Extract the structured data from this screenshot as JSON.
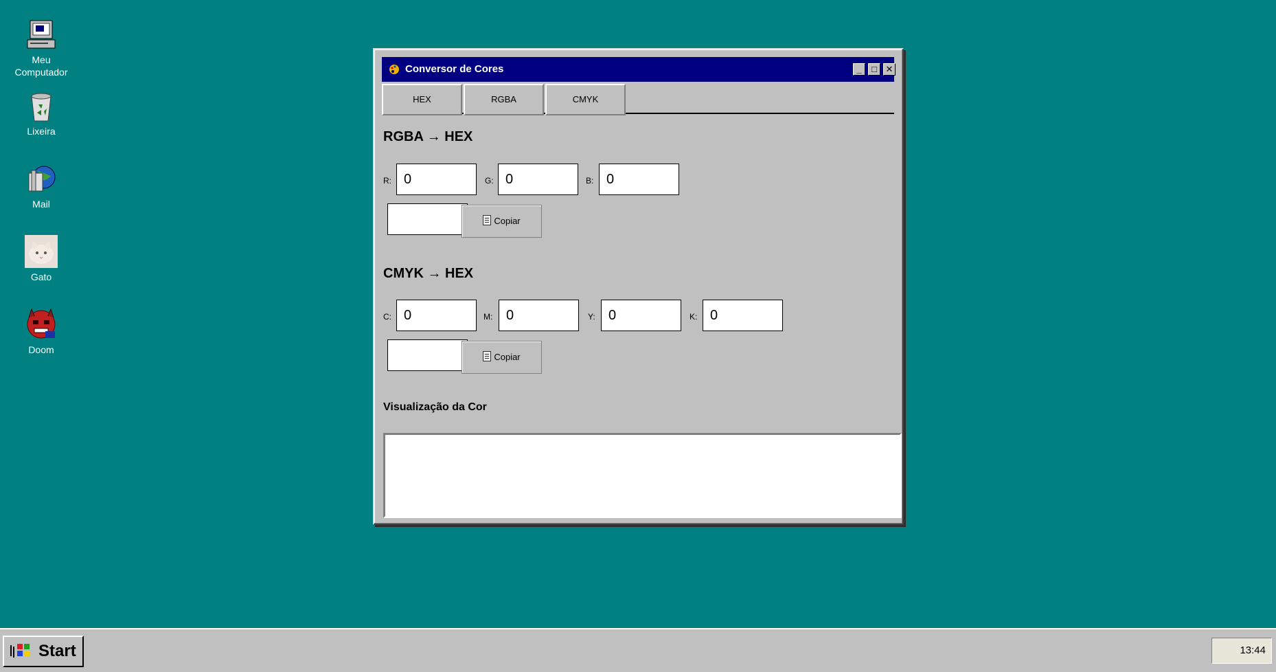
{
  "desktop": {
    "icons": [
      {
        "label": "Meu Computador",
        "icon": "computer-icon"
      },
      {
        "label": "Lixeira",
        "icon": "recycle-bin-icon"
      },
      {
        "label": "Mail",
        "icon": "mail-icon"
      },
      {
        "label": "Gato",
        "icon": "cat-photo-icon"
      },
      {
        "label": "Doom",
        "icon": "doom-icon"
      }
    ]
  },
  "window": {
    "title": "Conversor de Cores",
    "controls": {
      "minimize": "_",
      "maximize": "□",
      "close": "✕"
    },
    "tabs": [
      "HEX",
      "RGBA",
      "CMYK"
    ],
    "rgba_section": {
      "title": "RGBA → HEX",
      "fields": [
        {
          "label": "R:",
          "value": "0"
        },
        {
          "label": "G:",
          "value": "0"
        },
        {
          "label": "B:",
          "value": "0"
        }
      ],
      "result": "",
      "copy_label": "Copiar"
    },
    "cmyk_section": {
      "title": "CMYK → HEX",
      "fields": [
        {
          "label": "C:",
          "value": "0"
        },
        {
          "label": "M:",
          "value": "0"
        },
        {
          "label": "Y:",
          "value": "0"
        },
        {
          "label": "K:",
          "value": "0"
        }
      ],
      "result": "",
      "copy_label": "Copiar"
    },
    "preview_label": "Visualização da Cor",
    "preview_color": "#ffffff"
  },
  "taskbar": {
    "start_label": "Start",
    "clock": "13:44"
  },
  "colors": {
    "desktop": "#008080",
    "titlebar": "#000080",
    "chrome": "#c0c0c0"
  }
}
